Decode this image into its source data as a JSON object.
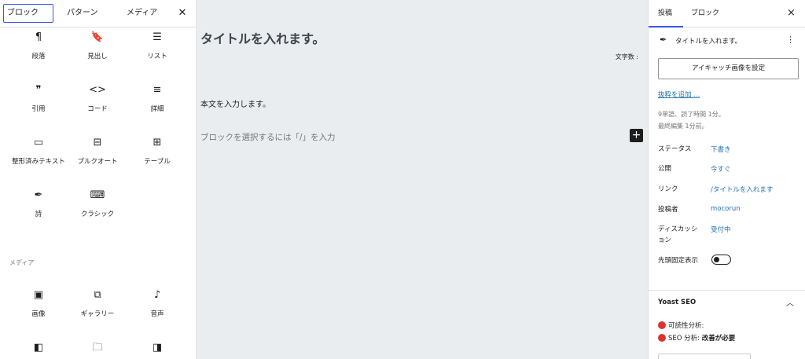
{
  "inserter": {
    "tabs": [
      "ブロック",
      "パターン",
      "メディア"
    ],
    "close_icon": "close-icon",
    "blocks": [
      {
        "label": "段落",
        "icon": "paragraph-icon",
        "glyph": "¶"
      },
      {
        "label": "見出し",
        "icon": "heading-bookmark-icon",
        "glyph": "🔖"
      },
      {
        "label": "リスト",
        "icon": "list-icon",
        "glyph": "☰"
      },
      {
        "label": "引用",
        "icon": "quote-icon",
        "glyph": "❞"
      },
      {
        "label": "コード",
        "icon": "code-icon",
        "glyph": "<>"
      },
      {
        "label": "詳細",
        "icon": "details-icon",
        "glyph": "≡"
      },
      {
        "label": "整形済みテキスト",
        "icon": "preformatted-icon",
        "glyph": "▭"
      },
      {
        "label": "プルクオート",
        "icon": "pullquote-icon",
        "glyph": "⊟"
      },
      {
        "label": "テーブル",
        "icon": "table-icon",
        "glyph": "⊞"
      },
      {
        "label": "詩",
        "icon": "verse-feather-icon",
        "glyph": "✒"
      },
      {
        "label": "クラシック",
        "icon": "keyboard-icon",
        "glyph": "⌨"
      }
    ],
    "media_section": "メディア",
    "media_blocks": [
      {
        "label": "画像",
        "icon": "image-icon",
        "glyph": "▣"
      },
      {
        "label": "ギャラリー",
        "icon": "gallery-icon",
        "glyph": "⧉"
      },
      {
        "label": "音声",
        "icon": "audio-note-icon",
        "glyph": "♪"
      },
      {
        "label": "",
        "icon": "cover-icon",
        "glyph": "◧"
      },
      {
        "label": "",
        "icon": "file-folder-icon",
        "glyph": "🗀"
      },
      {
        "label": "",
        "icon": "media-text-icon",
        "glyph": "◨"
      }
    ]
  },
  "canvas": {
    "title": "タイトルを入れます。",
    "word_count_label": "文字数 :",
    "body": "本文を入力します。",
    "placeholder": "ブロックを選択するには「/」を入力",
    "add_block": "+"
  },
  "settings": {
    "tabs": [
      "投稿",
      "ブロック"
    ],
    "close": "×",
    "post_title": "タイトルを入れます。",
    "more": "⋮",
    "featured_button": "アイキャッチ画像を設定",
    "excerpt_link": "抜粋を追加 ...",
    "meta_words": "9単語、読了時間 1分。",
    "meta_edited": "最終編集 1分前。",
    "rows": [
      {
        "label": "ステータス",
        "value": "下書き"
      },
      {
        "label": "公開",
        "value": "今すぐ"
      },
      {
        "label": "リンク",
        "value": "/タイトルを入れます"
      },
      {
        "label": "投稿者",
        "value": "mocorun"
      },
      {
        "label": "ディスカッション",
        "value": "受付中"
      }
    ],
    "sticky_label": "先頭固定表示",
    "sticky_on": false,
    "yoast_title": "Yoast SEO",
    "readability_label": "可読性分析:",
    "seo_label": "SEO 分析:",
    "seo_status": "改善が必要",
    "status_color": "#dc3232",
    "accent": "#3858e9",
    "link_color": "#2271b1"
  }
}
